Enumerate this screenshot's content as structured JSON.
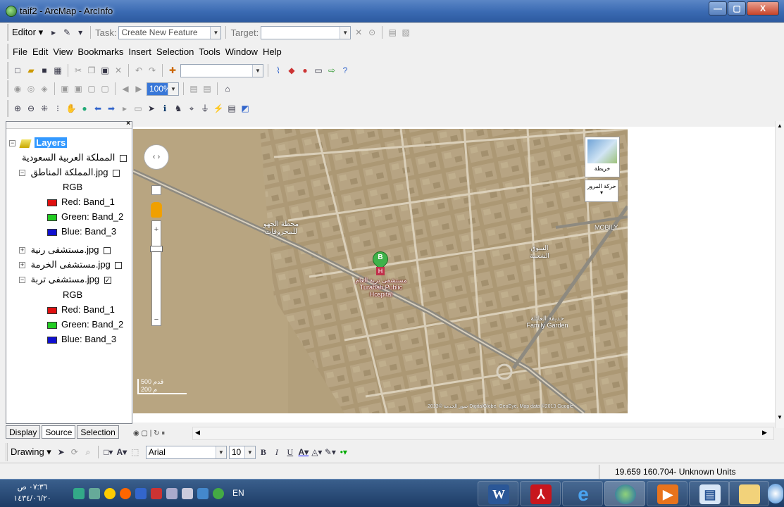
{
  "window": {
    "title": "taif2 - ArcMap - ArcInfo",
    "controls": {
      "minimize": "—",
      "maximize": "▢",
      "close": "X"
    }
  },
  "editor_toolbar": {
    "editor_label": "Editor ▾",
    "task_label": "Task:",
    "task_value": "Create New Feature",
    "target_label": "Target:",
    "target_value": ""
  },
  "menu": [
    "File",
    "Edit",
    "View",
    "Bookmarks",
    "Insert",
    "Selection",
    "Tools",
    "Window",
    "Help"
  ],
  "standard_toolbar": {
    "scale_value": ""
  },
  "layout_toolbar": {
    "zoom_value": "100%"
  },
  "toc": {
    "root": "Layers",
    "items": [
      {
        "label": "المملكة العربية السعودية",
        "checked": false,
        "expandable": false
      },
      {
        "label": "المملكة المناطق.jpg",
        "checked": false,
        "expandable": true
      },
      {
        "label": "RGB"
      },
      {
        "label": "Red:   Band_1",
        "color": "#e01010"
      },
      {
        "label": "Green: Band_2",
        "color": "#22cc22"
      },
      {
        "label": "Blue:  Band_3",
        "color": "#1010d0"
      },
      {
        "label": "مستشفى رنية.jpg",
        "checked": false,
        "expandable": true
      },
      {
        "label": "مستشفى الخرمة.jpg",
        "checked": false,
        "expandable": true
      },
      {
        "label": "مستشفى تربة.jpg",
        "checked": true,
        "expandable": true
      },
      {
        "label": "RGB"
      },
      {
        "label": "Red:   Band_1",
        "color": "#e01010"
      },
      {
        "label": "Green: Band_2",
        "color": "#22cc22"
      },
      {
        "label": "Blue:  Band_3",
        "color": "#1010d0"
      }
    ],
    "tabs": [
      "Display",
      "Source",
      "Selection"
    ]
  },
  "map": {
    "labels": {
      "station": "محطة الجهو للمحروقات",
      "hospital": "مستشفى تربة العام Turabah Public Hospital",
      "garden": "حديقة العائلة Family Garden",
      "mobily": "MOBILY",
      "right_label": "السوق الشعبية",
      "marker": "B",
      "hospital_icon": "H",
      "scale_top": "500 قدم",
      "scale_bottom": "200 م",
      "attribution": "صور الخدمة ©2013 DigitalGlobe, GeoEye, Map data ©2013 Google"
    },
    "inset_label": "خريطة",
    "traffic_label": "حركة المرور ▾"
  },
  "drawing_toolbar": {
    "drawing_label": "Drawing ▾",
    "font_name": "Arial",
    "font_size": "10"
  },
  "status": {
    "coordinates": "19.659  160.704- Unknown Units"
  },
  "taskbar": {
    "time": "٠٧:٣٦ ص",
    "date": "١٤٣٤/٠٦/٢٠",
    "lang": "EN"
  }
}
